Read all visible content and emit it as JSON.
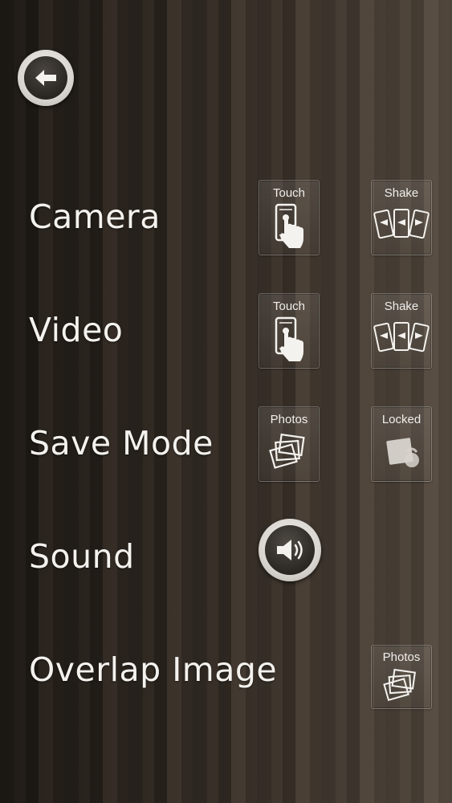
{
  "rows": {
    "camera": {
      "label": "Camera",
      "options": [
        {
          "label": "Touch",
          "icon": "touch-phone-icon"
        },
        {
          "label": "Shake",
          "icon": "shake-phones-icon"
        }
      ]
    },
    "video": {
      "label": "Video",
      "options": [
        {
          "label": "Touch",
          "icon": "touch-phone-icon"
        },
        {
          "label": "Shake",
          "icon": "shake-phones-icon"
        }
      ]
    },
    "save_mode": {
      "label": "Save Mode",
      "options": [
        {
          "label": "Photos",
          "icon": "photos-stack-icon"
        },
        {
          "label": "Locked",
          "icon": "locked-photo-icon"
        }
      ]
    },
    "sound": {
      "label": "Sound",
      "icon": "speaker-icon"
    },
    "overlap_image": {
      "label": "Overlap Image",
      "options": [
        {
          "label": "Photos",
          "icon": "photos-stack-icon"
        }
      ]
    }
  },
  "icons": {
    "back": "back-arrow-icon"
  },
  "colors": {
    "text": "#f4f2ee",
    "button_face": "#2a2622",
    "button_ring": "#d9d5d0"
  }
}
